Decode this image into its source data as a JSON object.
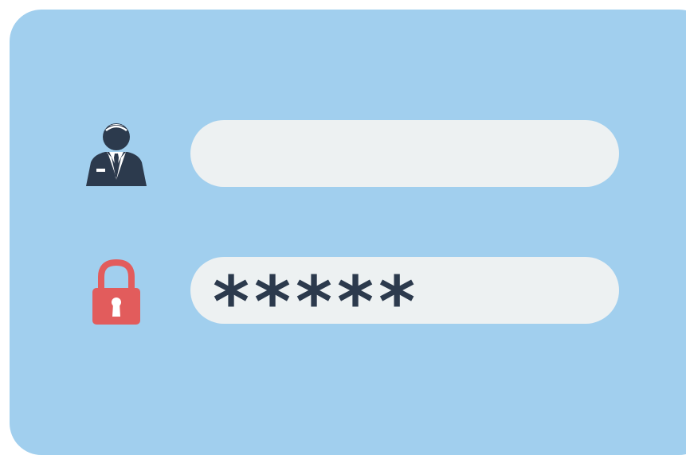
{
  "login_form": {
    "username": {
      "icon": "user-avatar-icon",
      "value": "",
      "placeholder": ""
    },
    "password": {
      "icon": "padlock-icon",
      "masked_value": "*****"
    }
  },
  "colors": {
    "panel_background": "#a1cfee",
    "field_background": "#edf1f2",
    "icon_dark": "#2c3a4d",
    "lock_red": "#e25c5c"
  }
}
